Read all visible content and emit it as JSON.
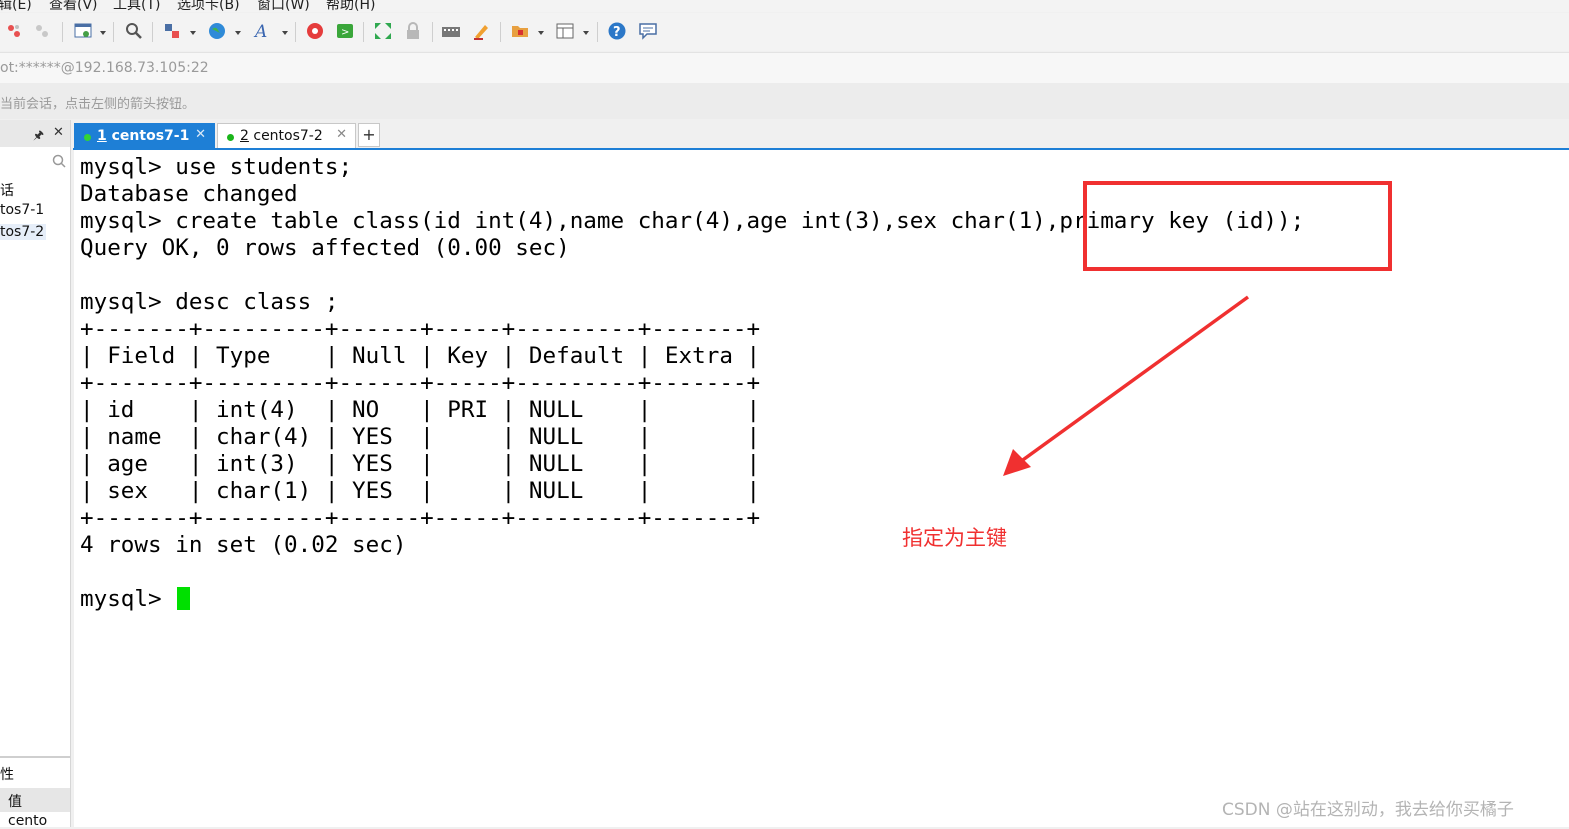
{
  "menubar": {
    "items": [
      "辑(E)",
      "查看(V)",
      "工具(T)",
      "选项卡(B)",
      "窗口(W)",
      "帮助(H)"
    ]
  },
  "toolbar": {
    "icons": [
      "new-session-icon",
      "disconnect-icon",
      "properties-icon",
      "find-icon",
      "transfer-icon",
      "globe-icon",
      "font-icon",
      "xftp-icon",
      "xshell-icon",
      "fullscreen-icon",
      "lock-icon",
      "keyboard-icon",
      "highlight-icon",
      "compose-icon",
      "layout-icon",
      "help-icon",
      "chat-icon"
    ]
  },
  "address": {
    "text": "ot:******@192.168.73.105:22"
  },
  "hint": {
    "text": "当前会话，点击左侧的箭头按钮。"
  },
  "sidebar": {
    "items": [
      "话",
      "tos7-1",
      "tos7-2"
    ],
    "properties_title": "性",
    "properties_col": "值",
    "properties_row": "cento"
  },
  "tabs": [
    {
      "number": "1",
      "name": " centos7-1",
      "active": true
    },
    {
      "number": "2",
      "name": " centos7-2",
      "active": false
    }
  ],
  "tab_add": "+",
  "terminal": {
    "lines": [
      "mysql> use students;",
      "Database changed",
      "mysql> create table class(id int(4),name char(4),age int(3),sex char(1),primary key (id));",
      "Query OK, 0 rows affected (0.00 sec)",
      "",
      "mysql> desc class ;",
      "+-------+---------+------+-----+---------+-------+",
      "| Field | Type    | Null | Key | Default | Extra |",
      "+-------+---------+------+-----+---------+-------+",
      "| id    | int(4)  | NO   | PRI | NULL    |       |",
      "| name  | char(4) | YES  |     | NULL    |       |",
      "| age   | int(3)  | YES  |     | NULL    |       |",
      "| sex   | char(1) | YES  |     | NULL    |       |",
      "+-------+---------+------+-----+---------+-------+",
      "4 rows in set (0.02 sec)",
      "",
      "mysql> "
    ]
  },
  "annotation": {
    "text": "指定为主键",
    "color": "#f03030"
  },
  "watermark": "CSDN @站在这别动，我去给你买橘子",
  "colors": {
    "tab_active": "#1e7fd6",
    "cursor": "#00e000",
    "annotation": "#f03030"
  }
}
